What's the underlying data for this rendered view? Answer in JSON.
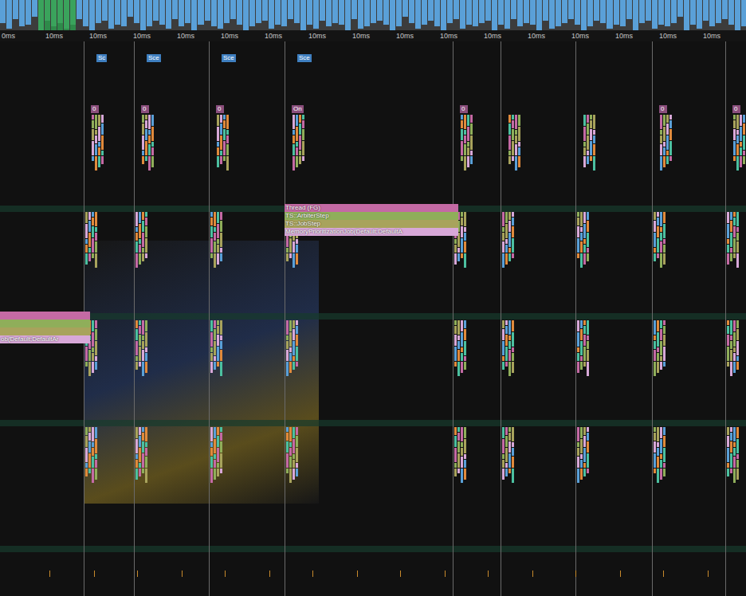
{
  "frame_graph": {
    "values_ms": [
      12,
      15,
      10,
      14,
      13,
      9,
      16,
      11,
      14,
      12,
      15,
      13,
      10,
      14,
      16,
      12,
      11,
      15,
      13,
      14,
      9,
      12,
      16,
      14,
      11,
      13,
      15,
      10,
      14,
      12,
      16,
      13,
      11,
      14,
      15,
      12,
      10,
      13,
      16,
      14,
      12,
      11,
      15,
      13,
      14,
      10,
      12,
      16,
      13,
      15,
      11,
      14,
      12,
      13,
      16,
      10,
      15,
      14,
      12,
      11,
      13,
      16,
      14,
      9,
      12,
      15,
      13,
      11,
      14,
      16,
      12,
      10,
      15,
      13,
      14,
      12,
      11,
      16,
      13,
      15,
      10,
      14,
      12,
      13,
      16,
      11,
      15,
      14,
      12,
      10,
      13,
      16,
      14,
      11,
      12,
      15,
      13,
      14,
      10,
      16,
      12,
      11,
      15,
      13,
      14,
      12,
      9,
      16,
      13,
      15,
      11,
      14,
      12,
      10,
      13,
      16,
      14
    ],
    "highlight": {
      "from": 6,
      "to": 11
    }
  },
  "time_ruler": [
    "0ms",
    "10ms",
    "10ms",
    "10ms",
    "10ms",
    "10ms",
    "10ms",
    "10ms",
    "10ms",
    "10ms",
    "10ms",
    "10ms",
    "10ms",
    "10ms",
    "10ms",
    "10ms",
    "10ms"
  ],
  "frames": [
    {
      "tag": "Sc",
      "marker": "0"
    },
    {
      "tag": "Sce",
      "marker": "0"
    },
    {
      "tag": "Sce",
      "marker": "0"
    },
    {
      "tag": "Sce",
      "marker": "On"
    },
    {
      "tag": "",
      "marker": "0"
    },
    {
      "tag": "",
      "marker": ""
    },
    {
      "tag": "",
      "marker": ""
    },
    {
      "tag": "",
      "marker": "0"
    },
    {
      "tag": "",
      "marker": "0"
    }
  ],
  "zone_stacks": [
    {
      "zones": [
        {
          "label": "Thread (FG)",
          "color": "#c46aa4"
        },
        {
          "label": "TS::ArbiterStep",
          "color": "#8fae5a"
        },
        {
          "label": "TS::JobStep",
          "color": "#a8a35c"
        },
        {
          "label": "MemoryPrioritizationJob(Default;DefaultA",
          "color": "#d8a8d8"
        }
      ]
    },
    {
      "zones": [
        {
          "label": "",
          "color": "#c46aa4"
        },
        {
          "label": "",
          "color": "#8fae5a"
        },
        {
          "label": "",
          "color": "#a8a35c"
        },
        {
          "label": "ob(Default;DefaultAr",
          "color": "#d8a8d8"
        }
      ]
    }
  ],
  "game_view": {
    "kind": "render"
  }
}
